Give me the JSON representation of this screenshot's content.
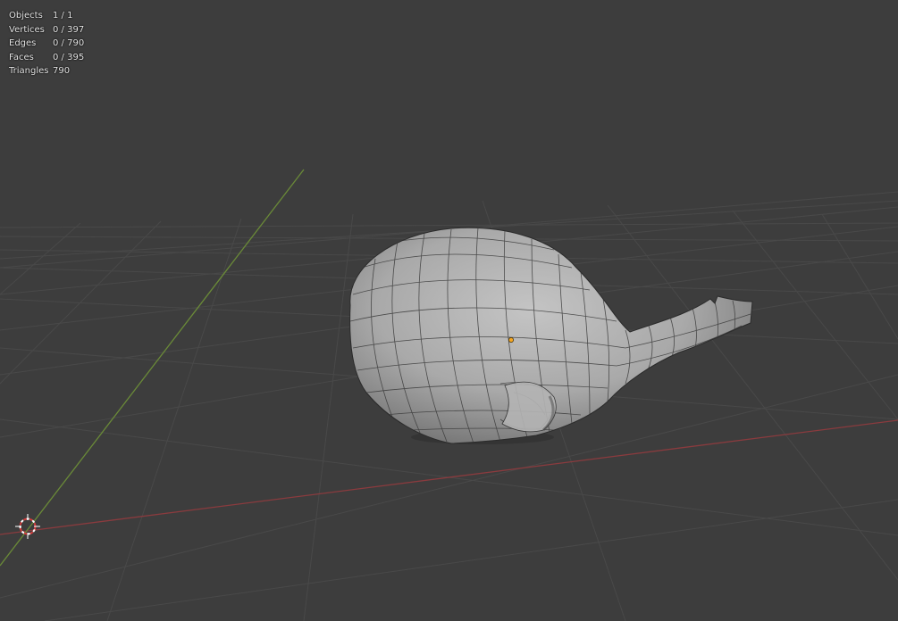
{
  "stats": [
    {
      "label": "Objects",
      "value": "1 / 1"
    },
    {
      "label": "Vertices",
      "value": "0 / 397"
    },
    {
      "label": "Edges",
      "value": "0 / 790"
    },
    {
      "label": "Faces",
      "value": "0 / 395"
    },
    {
      "label": "Triangles",
      "value": "790"
    }
  ],
  "colors": {
    "background": "#3d3d3d",
    "grid": "#494949",
    "x_axis": "#8a3b3e",
    "y_axis": "#6a8a38",
    "mesh_fill": "#a6a6a6",
    "mesh_wire": "#2e2e2e",
    "origin_dot": "#f5a623",
    "cursor_red": "#d33c3c"
  },
  "icons": {
    "cursor": "3d-cursor-icon",
    "origin": "object-origin-icon"
  }
}
